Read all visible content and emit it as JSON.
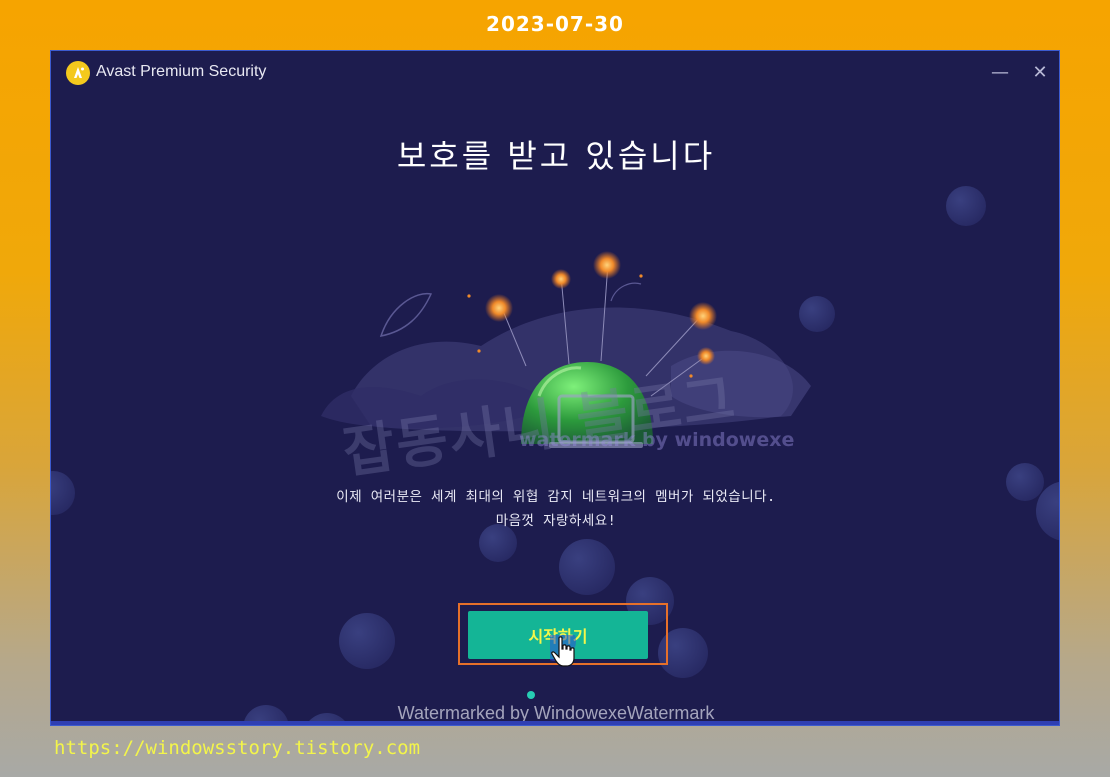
{
  "overlay": {
    "date": "2023-07-30",
    "url": "https://windowsstory.tistory.com"
  },
  "window": {
    "title": "Avast Premium Security",
    "minimize_label": "—",
    "close_label": "✕"
  },
  "main": {
    "heading": "보호를 받고 있습니다",
    "message_line1": "이제 여러분은 세계 최대의 위협 감지 네트워크의 멤버가 되었습니다.",
    "message_line2": "마음껏 자랑하세요!",
    "start_button_label": "시작하기"
  },
  "watermarks": {
    "korean": "잡동사니 블로그",
    "english": "watermark by windowexe",
    "bottom": "Watermarked by WindowexeWatermark"
  },
  "colors": {
    "window_bg": "#1d1c4e",
    "accent_button": "#14b596",
    "button_text": "#f3f74a",
    "highlight_border": "#e6702a",
    "logo": "#f4c91d"
  },
  "icons": [
    "avast-logo-icon",
    "minimize-icon",
    "close-icon",
    "hand-cursor-icon"
  ]
}
